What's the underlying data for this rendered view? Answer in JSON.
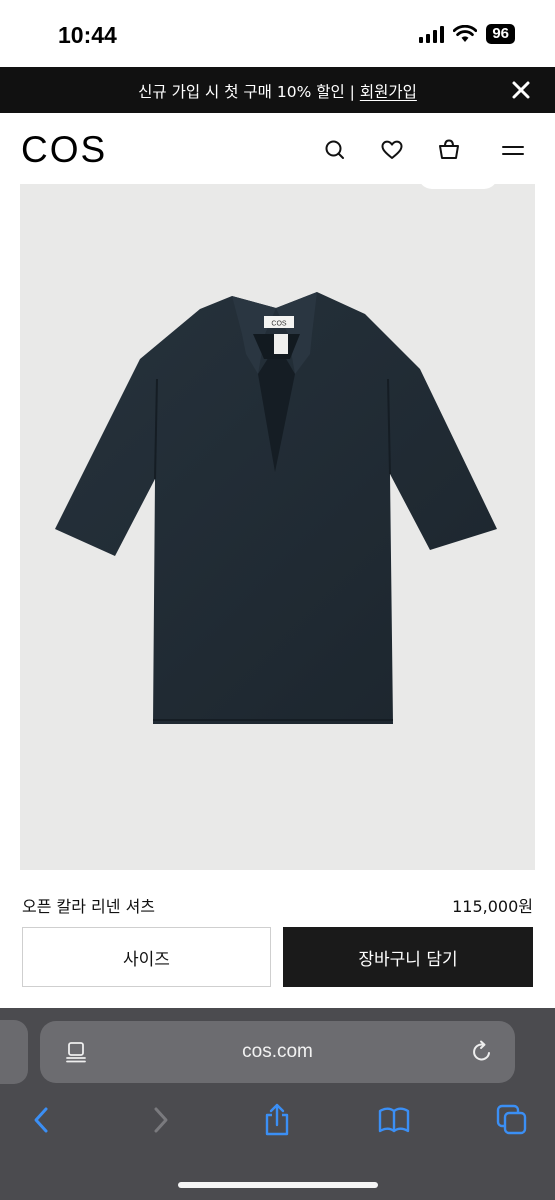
{
  "status_bar": {
    "time": "10:44",
    "battery": "96"
  },
  "promo": {
    "text": "신규 가입 시 첫 구매 10% 할인 | ",
    "link": "회원가입"
  },
  "header": {
    "logo": "COS"
  },
  "product": {
    "name": "오픈 칼라 리넨 셔츠",
    "price": "115,000원",
    "label_brand": "COS",
    "image_background": "#e9e9e8",
    "garment_color": "#1f2a33"
  },
  "buttons": {
    "size": "사이즈",
    "add_to_cart": "장바구니 담기"
  },
  "browser": {
    "url": "cos.com"
  },
  "colors": {
    "banner": "#111111",
    "cart_button": "#1a1a1a",
    "browser_chrome": "#4b4b4f",
    "toolbar_accent": "#3b8ff5"
  }
}
